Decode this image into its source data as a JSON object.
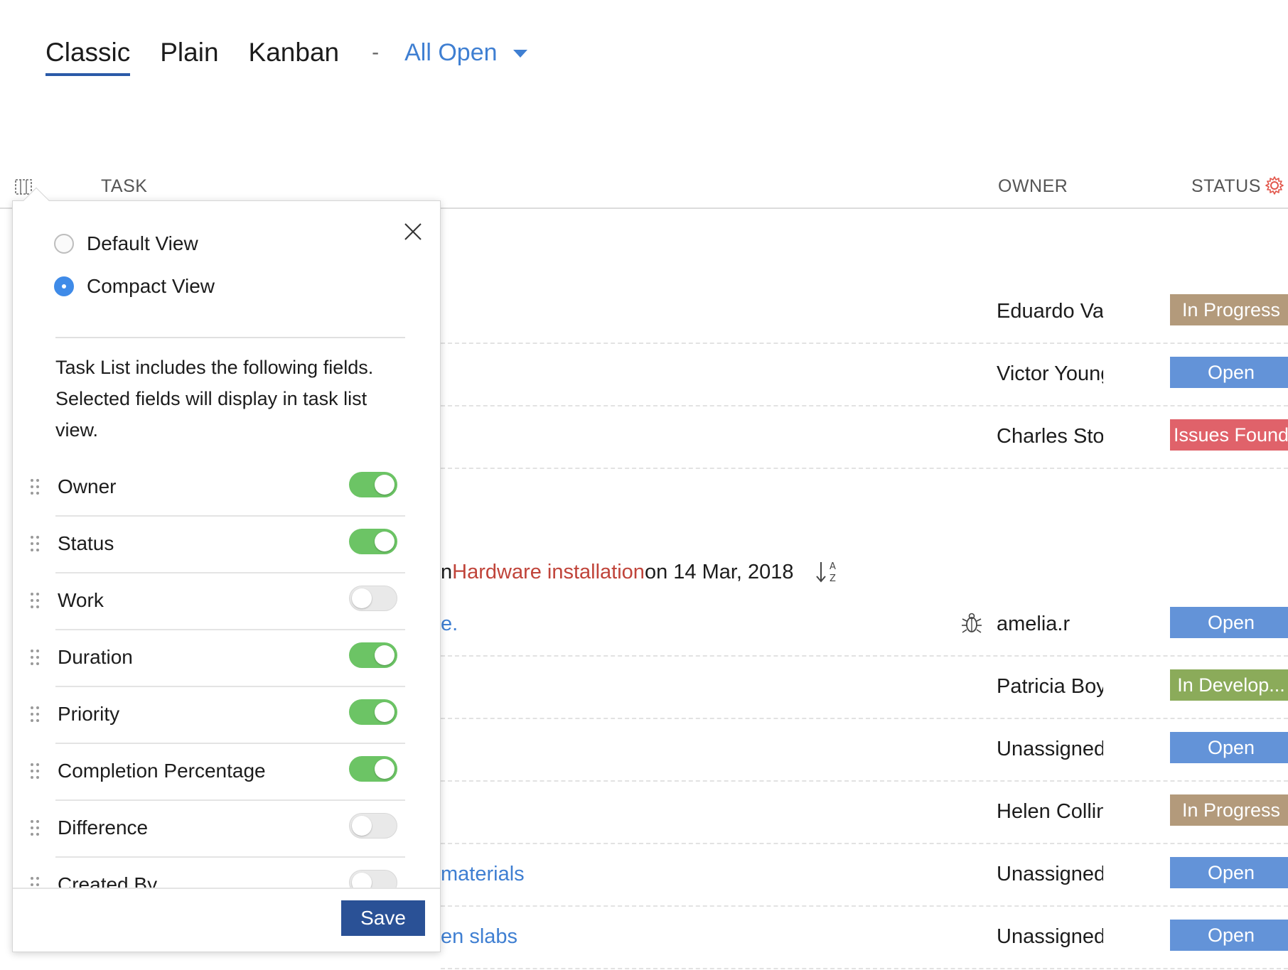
{
  "tabs": [
    {
      "label": "Classic",
      "active": true
    },
    {
      "label": "Plain",
      "active": false
    },
    {
      "label": "Kanban",
      "active": false
    }
  ],
  "separator": "-",
  "filter": {
    "label": "All Open"
  },
  "table": {
    "headers": {
      "task": "TASK",
      "owner": "OWNER",
      "status": "STATUS"
    }
  },
  "rows_top": [
    {
      "task": "",
      "owner": "Eduardo Var",
      "status": "In Progress",
      "status_color": "#b39a7b"
    },
    {
      "task": "",
      "owner": "Victor Young",
      "status": "Open",
      "status_color": "#6393d8"
    },
    {
      "task": "",
      "owner": "Charles Stor",
      "status": "Issues Found",
      "status_color": "#e0626a"
    }
  ],
  "group": {
    "prefix": "n ",
    "link": "Hardware installation",
    "suffix": " on 14 Mar, 2018"
  },
  "rows_bottom": [
    {
      "task": "e.",
      "owner": "amelia.r",
      "status": "Open",
      "status_color": "#6393d8",
      "bug": true
    },
    {
      "task": "",
      "owner": "Patricia Boy",
      "status": "In Develop...",
      "status_color": "#8bab5a"
    },
    {
      "task": "",
      "owner": "Unassigned",
      "status": "Open",
      "status_color": "#6393d8"
    },
    {
      "task": "",
      "owner": "Helen Collin",
      "status": "In Progress",
      "status_color": "#b39a7b"
    },
    {
      "task": "materials",
      "owner": "Unassigned",
      "status": "Open",
      "status_color": "#6393d8"
    },
    {
      "task": "en slabs",
      "owner": "Unassigned",
      "status": "Open",
      "status_color": "#6393d8"
    }
  ],
  "popup": {
    "views": [
      {
        "label": "Default View",
        "selected": false
      },
      {
        "label": "Compact View",
        "selected": true
      }
    ],
    "description": "Task List includes the following fields. Selected fields will display in task list view.",
    "fields": [
      {
        "name": "Owner",
        "enabled": true
      },
      {
        "name": "Status",
        "enabled": true
      },
      {
        "name": "Work",
        "enabled": false
      },
      {
        "name": "Duration",
        "enabled": true
      },
      {
        "name": "Priority",
        "enabled": true
      },
      {
        "name": "Completion Percentage",
        "enabled": true
      },
      {
        "name": "Difference",
        "enabled": false
      },
      {
        "name": "Created By",
        "enabled": false
      }
    ],
    "save_label": "Save"
  }
}
